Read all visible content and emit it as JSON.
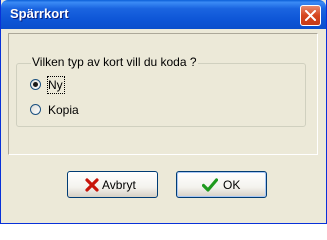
{
  "window": {
    "title": "Spärrkort"
  },
  "group": {
    "legend": "Vilken typ av kort vill du koda ?",
    "options": [
      {
        "label": "Ny",
        "selected": true
      },
      {
        "label": "Kopia",
        "selected": false
      }
    ]
  },
  "buttons": {
    "cancel": {
      "label": "Avbryt",
      "icon": "red-x-icon"
    },
    "ok": {
      "label": "OK",
      "icon": "green-check-icon"
    }
  },
  "colors": {
    "titlebar": "#0d55d6",
    "dialog_bg": "#ece9d8",
    "close_button": "#d6461e"
  }
}
